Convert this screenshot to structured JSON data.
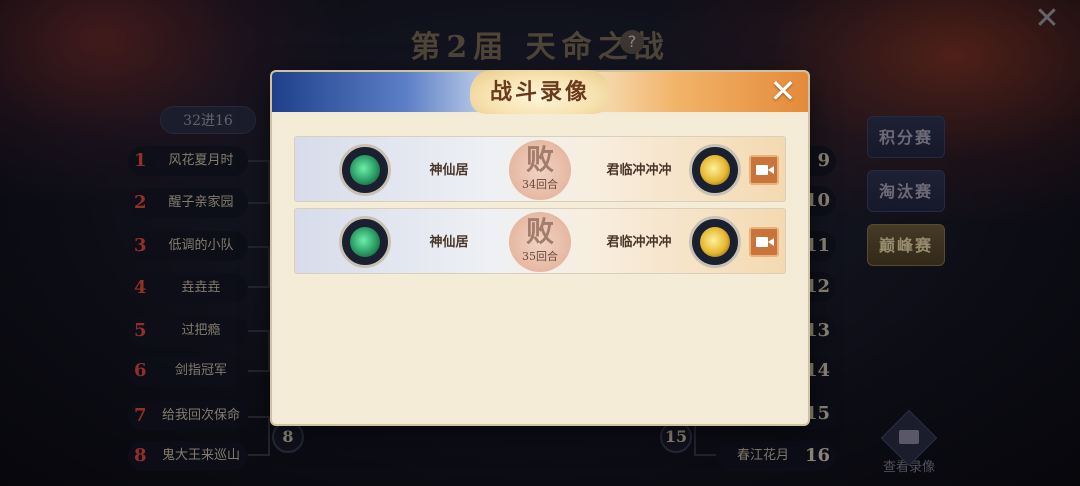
{
  "page": {
    "title": "第2届  天命之战",
    "round_tab": "32进16"
  },
  "bracket": {
    "left": [
      {
        "seed": "1",
        "name": "风花夏月时"
      },
      {
        "seed": "2",
        "name": "醒子亲家园"
      },
      {
        "seed": "3",
        "name": "低调的小队"
      },
      {
        "seed": "4",
        "name": "垚垚垚"
      },
      {
        "seed": "5",
        "name": "过把瘾"
      },
      {
        "seed": "6",
        "name": "剑指冠军"
      },
      {
        "seed": "7",
        "name": "给我回次保命"
      },
      {
        "seed": "8",
        "name": "鬼大王来巡山"
      }
    ],
    "right": [
      {
        "seed": "9",
        "name": ""
      },
      {
        "seed": "10",
        "name": ""
      },
      {
        "seed": "11",
        "name": ""
      },
      {
        "seed": "12",
        "name": ""
      },
      {
        "seed": "13",
        "name": ""
      },
      {
        "seed": "14",
        "name": ""
      },
      {
        "seed": "15",
        "name": ""
      },
      {
        "seed": "16",
        "name": "春江花月"
      }
    ],
    "mid_left": "8",
    "mid_right": "15"
  },
  "side_menu": {
    "points": "积分赛",
    "knockout": "淘汰赛",
    "peak": "巅峰赛",
    "active": "巅峰赛"
  },
  "replay_button": "查看录像",
  "modal": {
    "title": "战斗录像",
    "records": [
      {
        "player_left": "神仙居",
        "result": "败",
        "rounds": "34回合",
        "player_right": "君临冲冲冲"
      },
      {
        "player_left": "神仙居",
        "result": "败",
        "rounds": "35回合",
        "player_right": "君临冲冲冲"
      }
    ]
  },
  "colors": {
    "seed_red": "#e04a3a",
    "active_tab": "#6b5a38",
    "modal_bg": "#f3ead7",
    "video_button": "#c9743a"
  }
}
